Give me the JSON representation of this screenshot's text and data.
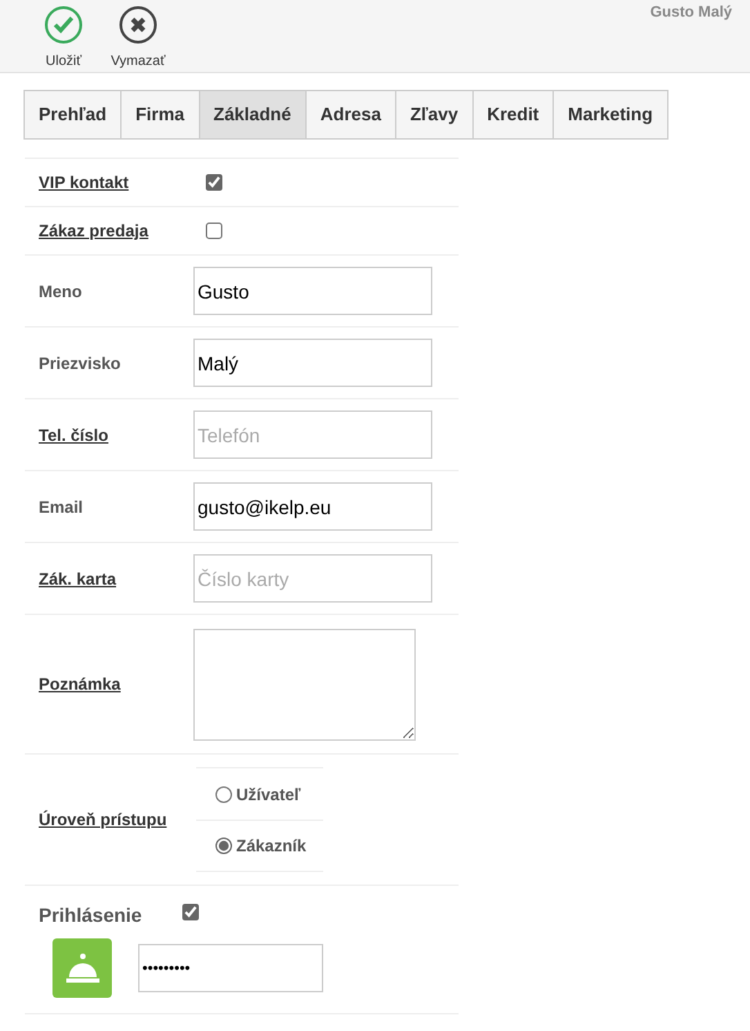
{
  "toolbar": {
    "buttons": [
      {
        "kind": "save",
        "label": "Uložiť"
      },
      {
        "kind": "delete",
        "label": "Vymazať"
      }
    ],
    "user": "Gusto Malý"
  },
  "tabs": [
    {
      "label": "Prehľad",
      "selected": false
    },
    {
      "label": "Firma",
      "selected": false
    },
    {
      "label": "Základné",
      "selected": true
    },
    {
      "label": "Adresa",
      "selected": false
    },
    {
      "label": "Zľavy",
      "selected": false
    },
    {
      "label": "Kredit",
      "selected": false
    },
    {
      "label": "Marketing",
      "selected": false
    }
  ],
  "form": [
    {
      "kind": "checkbox",
      "label": "VIP kontakt",
      "link": true,
      "checked": true
    },
    {
      "kind": "checkbox",
      "label": "Zákaz predaja",
      "link": true,
      "checked": false
    },
    {
      "kind": "input",
      "label": "Meno",
      "link": false,
      "value": "Gusto"
    },
    {
      "kind": "input",
      "label": "Priezvisko",
      "link": false,
      "value": "Malý"
    },
    {
      "kind": "input",
      "label": "Tel. číslo",
      "link": true,
      "placeholder": "Telefón"
    },
    {
      "kind": "input",
      "label": "Email",
      "link": false,
      "value": "gusto@ikelp.eu"
    },
    {
      "kind": "input",
      "label": "Zák. karta",
      "link": true,
      "placeholder": "Číslo karty"
    },
    {
      "kind": "textarea",
      "label": "Poznámka",
      "link": true
    },
    {
      "kind": "radio",
      "label": "Úroveň prístupu",
      "link": true,
      "options": [
        {
          "label": "Užívateľ",
          "selected": false
        },
        {
          "label": "Zákazník",
          "selected": true
        }
      ]
    },
    {
      "kind": "login",
      "label": "Prihlásenie",
      "link": false,
      "checked": true,
      "password": "•••••••••"
    }
  ]
}
